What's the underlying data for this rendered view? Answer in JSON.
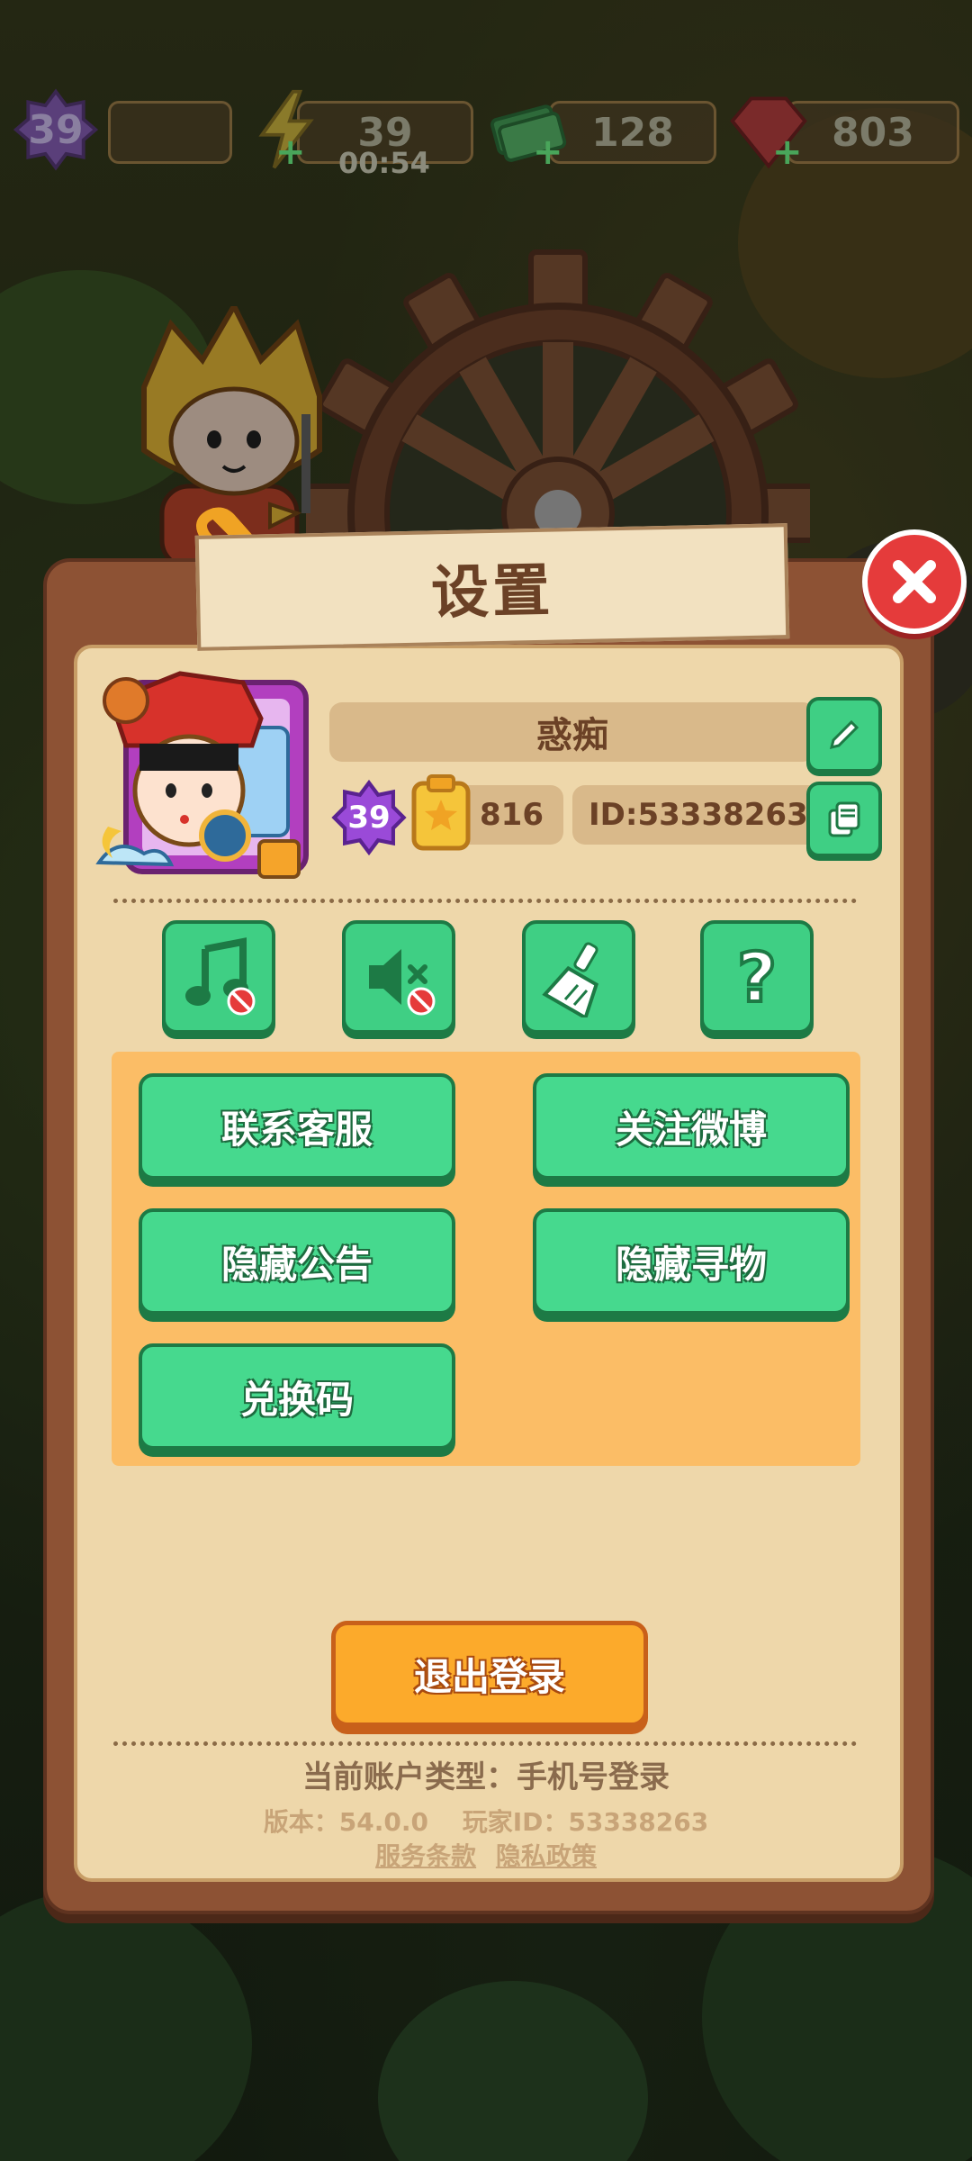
{
  "hud": {
    "level": "39",
    "energy": "39",
    "energy_timer": "00:54",
    "cash": "128",
    "gems": "803"
  },
  "dialog": {
    "title": "设置"
  },
  "profile": {
    "name": "惑痴",
    "level": "39",
    "stat_value": "816",
    "player_id": "ID:53338263"
  },
  "toggles": [
    {
      "icon": "music-note-muted-icon"
    },
    {
      "icon": "speaker-muted-icon"
    },
    {
      "icon": "broom-icon"
    },
    {
      "icon": "question-icon"
    }
  ],
  "actions": {
    "contact_support": "联系客服",
    "follow_weibo": "关注微博",
    "hide_announcement": "隐藏公告",
    "hide_search": "隐藏寻物",
    "redeem_code": "兑换码"
  },
  "logout": "退出登录",
  "footer": {
    "account_type": "当前账户类型：手机号登录",
    "version": "版本：54.0.0",
    "player_id": "玩家ID：53338263",
    "terms": "服务条款",
    "privacy": "隐私政策"
  },
  "colors": {
    "green": "#46d98e",
    "orange": "#fcaa2b",
    "panel_brown": "#8d5234",
    "panel_cream": "#eed7aa",
    "close_red": "#e53b3b"
  }
}
